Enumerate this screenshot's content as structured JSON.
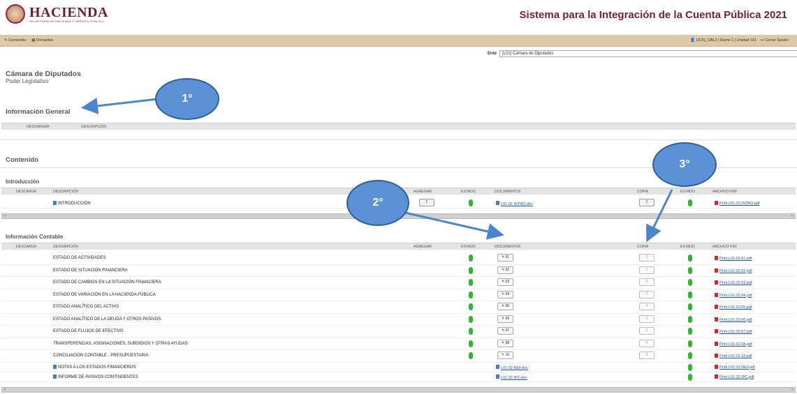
{
  "header": {
    "logo_text": "HACIENDA",
    "logo_subtext": "SECRETARÍA DE HACIENDA Y CRÉDITO PÚBLICO",
    "system_title": "Sistema para la Integración de la Cuenta Pública 2021"
  },
  "navbar": {
    "left_items": [
      "✎ Contenido",
      "▦ Firmantes"
    ],
    "user_info": "👤 UCIS_CBL2 | Ramo 1 | Unidad 101",
    "logout": "↦ Cerrar Sesión"
  },
  "ente": {
    "label": "Ente",
    "value": "[L01] Cámara de Diputados"
  },
  "entity": {
    "name": "Cámara de Diputados",
    "branch": "Poder Legislativo"
  },
  "sections": {
    "info_general": "Información General",
    "contenido": "Contenido",
    "introduccion": "Introducción",
    "info_contable": "Información Contable"
  },
  "info_general_headers": {
    "descargar": "DESCARGAR",
    "descripcion": "DESCRIPCIÓN"
  },
  "table_headers": {
    "descarga": "DESCARGA",
    "descripcion": "DESCRIPCIÓN",
    "agregar": "AGREGAR",
    "estado": "ESTADO",
    "documentos": "DOCUMENTOS",
    "copia": "COPIA",
    "estado2": "ESTADO",
    "archivo_pdf": "ARCHIVO PDF"
  },
  "intro_row": {
    "descripcion": "INTRODUCCIÓN",
    "upload_icon": "upload-icon",
    "documento": "L01.01.INTRO.doc",
    "pdf": "Print L01.01.INTRO.pdf"
  },
  "contable_rows": [
    {
      "descripcion": "ESTADO DE ACTIVIDADES",
      "doc_btn": "01",
      "pdf": "Print L01.02.01.pdf"
    },
    {
      "descripcion": "ESTADO DE SITUACIÓN FINANCIERA",
      "doc_btn": "02",
      "pdf": "Print L01.02.02.pdf"
    },
    {
      "descripcion": "ESTADO DE CAMBIOS EN LA SITUACIÓN FINANCIERA",
      "doc_btn": "03",
      "pdf": "Print L01.02.03.pdf"
    },
    {
      "descripcion": "ESTADO DE VARIACIÓN EN LA HACIENDA PÚBLICA",
      "doc_btn": "04",
      "pdf": "Print L01.02.04.pdf"
    },
    {
      "descripcion": "ESTADO ANALÍTICO DEL ACTIVO",
      "doc_btn": "05",
      "pdf": "Print L01.02.05.pdf"
    },
    {
      "descripcion": "ESTADO ANALÍTICO DE LA DEUDA Y OTROS PASIVOS",
      "doc_btn": "06",
      "pdf": "Print L01.02.06.pdf"
    },
    {
      "descripcion": "ESTADO DE FLUJOS DE EFECTIVO",
      "doc_btn": "07",
      "pdf": "Print L01.02.07.pdf"
    },
    {
      "descripcion": "TRANSFERENCIAS, ASIGNACIONES, SUBSIDIOS Y OTRAS AYUDAS",
      "doc_btn": "08",
      "pdf": "Print L01.02.08.pdf"
    },
    {
      "descripcion": "CONCILIACIÓN CONTABLE - PRESUPUESTARIA",
      "doc_btn": "10",
      "pdf": "Print L01.02.10.pdf"
    }
  ],
  "contable_doc_rows": [
    {
      "descripcion": "NOTAS A LOS ESTADOS FINANCIEROS",
      "documento": "L01.02.NEF.doc",
      "pdf": "Print L01.02.NEF.pdf"
    },
    {
      "descripcion": "INFORME DE PASIVOS CONTINGENTES",
      "documento": "L01.02.IPC.doc",
      "pdf": "Print L01.02.IPC.pdf"
    }
  ],
  "annotations": [
    "1°",
    "2°",
    "3°"
  ],
  "colors": {
    "brand": "#9d2449",
    "navbar": "#ddc9a3",
    "status_ok": "#2eb82e",
    "link": "#1a56b8",
    "bubble": "#5b92d6"
  }
}
